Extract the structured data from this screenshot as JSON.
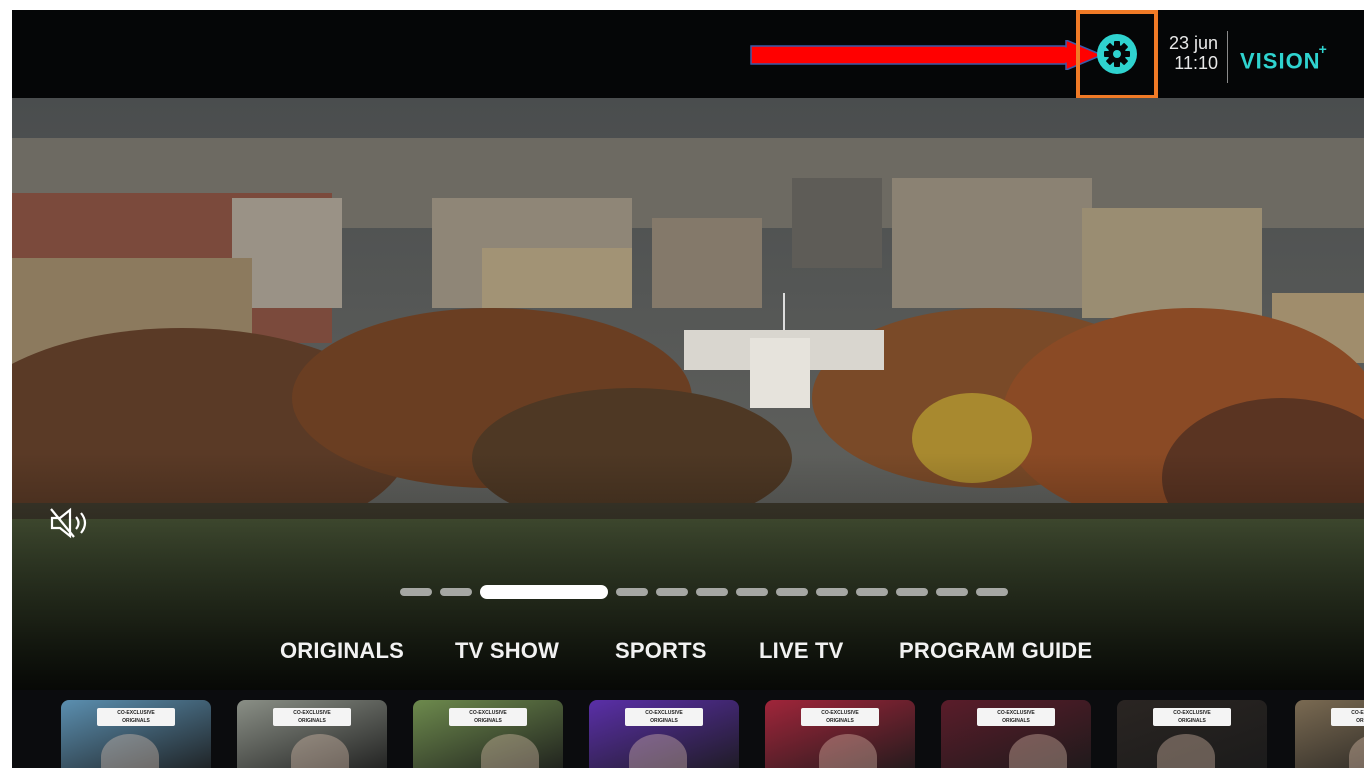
{
  "header": {
    "date": "23 jun",
    "time": "11:10",
    "logo": "VISION",
    "logo_plus": "+",
    "search_icon": "search-icon",
    "settings_icon": "gear-icon",
    "accent": "#2fd3cf",
    "highlight_color": "#f07a26",
    "arrow_color": "#ff0000"
  },
  "hero": {
    "mute_icon": "speaker-muted-icon",
    "carousel": {
      "count": 13,
      "active_index": 2
    }
  },
  "nav": {
    "items": [
      "ORIGINALS",
      "TV SHOW",
      "SPORTS",
      "LIVE TV",
      "PROGRAM GUIDE"
    ]
  },
  "rail": {
    "cards": [
      {
        "tag_line1": "CO-EXCLUSIVE",
        "tag_line2": "ORIGINALS",
        "color": "#5b8fb0"
      },
      {
        "tag_line1": "CO-EXCLUSIVE",
        "tag_line2": "ORIGINALS",
        "color": "#8a8f86"
      },
      {
        "tag_line1": "CO-EXCLUSIVE",
        "tag_line2": "ORIGINALS",
        "color": "#6d8a4d"
      },
      {
        "tag_line1": "CO-EXCLUSIVE",
        "tag_line2": "ORIGINALS",
        "color": "#5a2fa8"
      },
      {
        "tag_line1": "CO-EXCLUSIVE",
        "tag_line2": "ORIGINALS",
        "color": "#a0253a"
      },
      {
        "tag_line1": "CO-EXCLUSIVE",
        "tag_line2": "ORIGINALS",
        "color": "#5a1c2a"
      },
      {
        "tag_line1": "CO-EXCLUSIVE",
        "tag_line2": "ORIGINALS",
        "color": "#2a2522"
      },
      {
        "tag_line1": "CO-EXCLUSIVE",
        "tag_line2": "ORIGINALS",
        "color": "#7a6a52"
      }
    ]
  }
}
